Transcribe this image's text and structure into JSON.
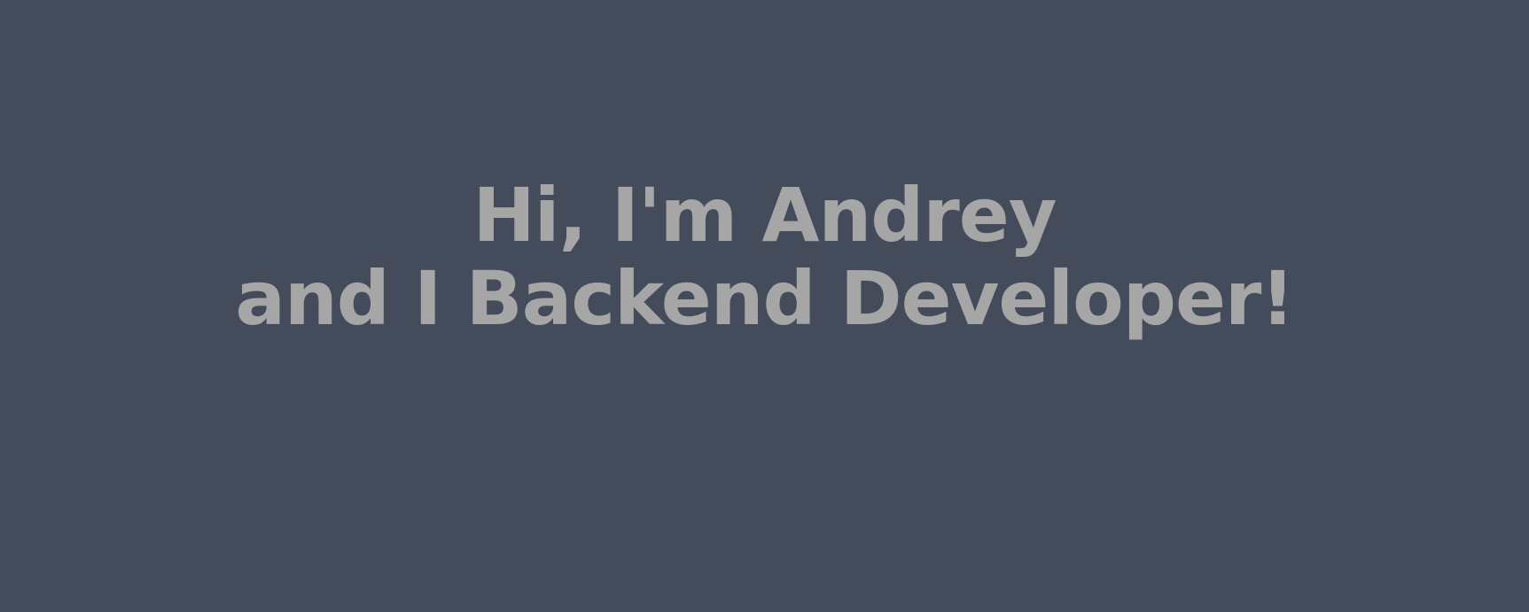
{
  "hero": {
    "line1": "Hi, I'm Andrey",
    "line2": "and I Backend Developer!"
  },
  "colors": {
    "background": "#444b5b",
    "text": "#a6a6a6"
  }
}
